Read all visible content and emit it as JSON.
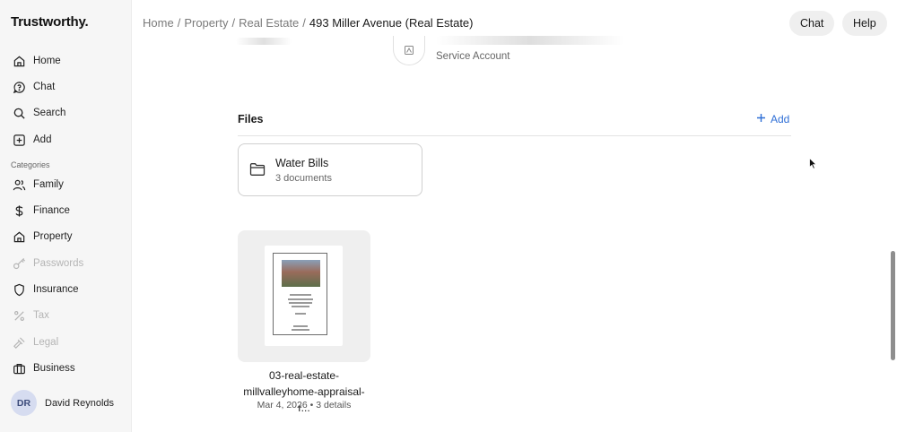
{
  "app": {
    "logo": "Trustworthy."
  },
  "sidebar": {
    "nav": [
      {
        "label": "Home",
        "icon": "home-icon"
      },
      {
        "label": "Chat",
        "icon": "chat-icon"
      },
      {
        "label": "Search",
        "icon": "search-icon"
      },
      {
        "label": "Add",
        "icon": "add-icon"
      }
    ],
    "categories_label": "Categories",
    "categories": [
      {
        "label": "Family",
        "icon": "family-icon",
        "enabled": true
      },
      {
        "label": "Finance",
        "icon": "dollar-icon",
        "enabled": true
      },
      {
        "label": "Property",
        "icon": "home-icon",
        "enabled": true
      },
      {
        "label": "Passwords",
        "icon": "key-icon",
        "enabled": false
      },
      {
        "label": "Insurance",
        "icon": "shield-icon",
        "enabled": true
      },
      {
        "label": "Tax",
        "icon": "percent-icon",
        "enabled": false
      },
      {
        "label": "Legal",
        "icon": "gavel-icon",
        "enabled": false
      },
      {
        "label": "Business",
        "icon": "briefcase-icon",
        "enabled": true
      }
    ],
    "user": {
      "initials": "DR",
      "name": "David Reynolds"
    }
  },
  "header": {
    "breadcrumb": [
      "Home",
      "Property",
      "Real Estate"
    ],
    "separator": "/",
    "current": "493 Miller Avenue (Real Estate)",
    "chat_label": "Chat",
    "help_label": "Help"
  },
  "main": {
    "service_account_label": "Service Account",
    "files": {
      "title": "Files",
      "add_label": "Add",
      "folder": {
        "name": "Water Bills",
        "count": "3 documents"
      },
      "document": {
        "name": "03-real-estate-millvalleyhome-appraisal-r...",
        "date": "Mar 4, 2026",
        "details": "3 details"
      }
    }
  },
  "colors": {
    "accent": "#2f6fd6",
    "sidebar_bg": "#f6f6f6",
    "avatar_bg": "#d6dcf0"
  }
}
